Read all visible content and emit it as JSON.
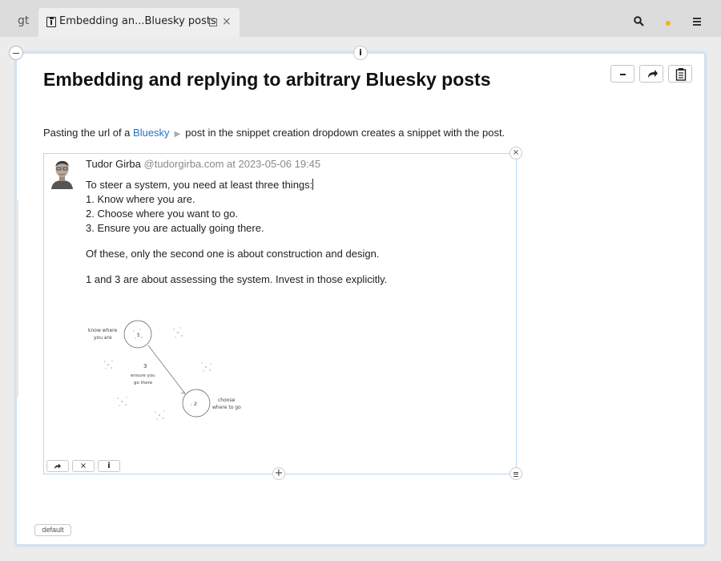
{
  "app": {
    "logo": "gt"
  },
  "tab": {
    "title": "Embedding an...Bluesky posts",
    "icon": "document-info-icon",
    "close": "×"
  },
  "toolbar": {
    "accent_dot_color": "#f5b21a"
  },
  "page": {
    "title": "Embedding and replying to arbitrary Bluesky posts",
    "intro_before": "Pasting the url of a",
    "intro_link": "Bluesky",
    "intro_after": "post in the snippet creation dropdown creates a snippet with the post.",
    "tree_info": "i",
    "badge": "default"
  },
  "post": {
    "author": "Tudor Girba",
    "handle_time": "@tudorgirba.com at 2023-05-06 19:45",
    "lines": [
      "To steer a system, you need at least three things:",
      "1. Know where you are.",
      "2. Choose where you want to go.",
      "3. Ensure you are actually going there.",
      "Of these, only the second one is about construction and design.",
      "1 and 3 are about assessing the system. Invest in those explicitly."
    ],
    "sketch": {
      "label1a": "know where",
      "label1b": "you are",
      "num2": "2",
      "label2a": "choose",
      "label2b": "where to go",
      "num3": "3",
      "label3a": "ensure you",
      "label3b": "go there",
      "num1": "1"
    }
  },
  "snippet": {
    "close": "×",
    "add": "+",
    "info": "i",
    "remove": "×"
  }
}
